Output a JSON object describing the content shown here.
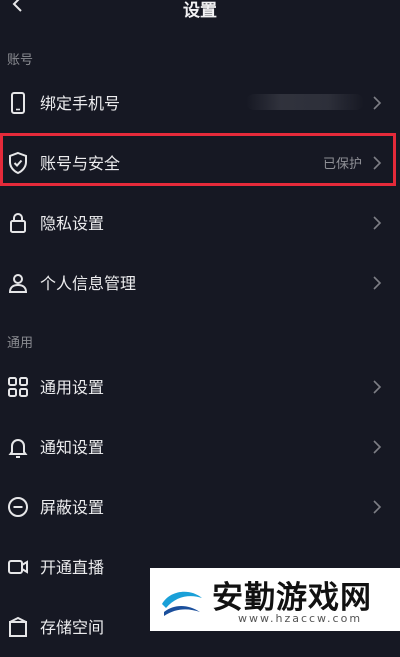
{
  "header": {
    "title": "设置"
  },
  "sections": {
    "account": "账号",
    "general": "通用"
  },
  "rows": [
    {
      "label": "绑定手机号",
      "value": ""
    },
    {
      "label": "账号与安全",
      "value": "已保护"
    },
    {
      "label": "隐私设置",
      "value": ""
    },
    {
      "label": "个人信息管理",
      "value": ""
    },
    {
      "label": "通用设置",
      "value": ""
    },
    {
      "label": "通知设置",
      "value": ""
    },
    {
      "label": "屏蔽设置",
      "value": ""
    },
    {
      "label": "开通直播",
      "value": ""
    },
    {
      "label": "存储空间",
      "value": ""
    }
  ],
  "watermark": {
    "name": "安勤游戏网",
    "url": "www.hzaccw.com"
  },
  "colors": {
    "background": "#161823",
    "highlight": "#e52a3a"
  }
}
